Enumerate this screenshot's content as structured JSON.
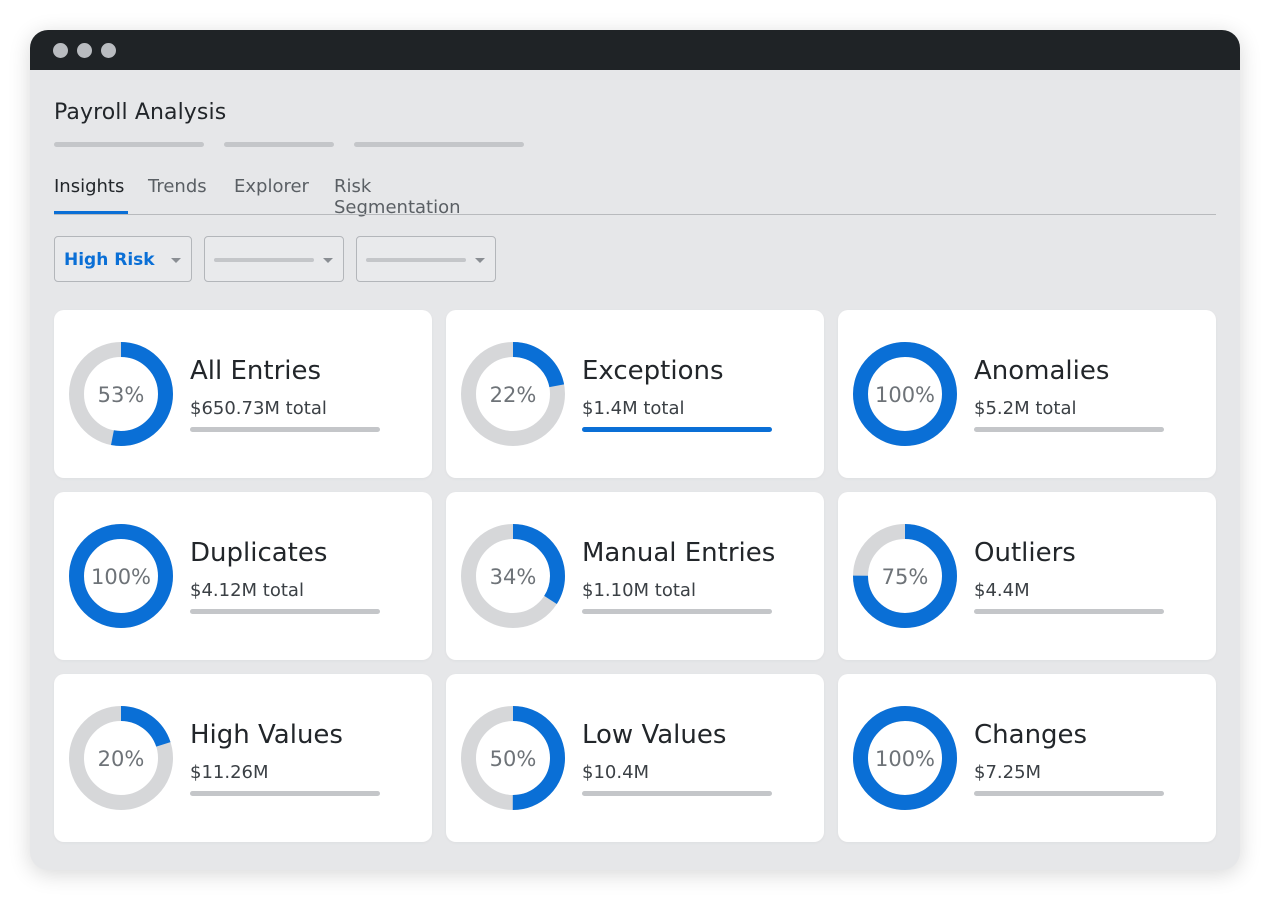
{
  "app": {
    "title": "Payroll Analysis"
  },
  "tabs": [
    {
      "label": "Insights",
      "active": true
    },
    {
      "label": "Trends",
      "active": false
    },
    {
      "label": "Explorer",
      "active": false
    },
    {
      "label": "Risk Segmentation",
      "active": false
    }
  ],
  "filters": [
    {
      "value": "High Risk"
    },
    {
      "value": ""
    },
    {
      "value": ""
    }
  ],
  "colors": {
    "accent": "#0a6fd6",
    "track": "#d6d7d9",
    "card_bg": "#ffffff",
    "window_bg": "#e6e7e9",
    "titlebar": "#1f2326"
  },
  "cards": [
    {
      "title": "All Entries",
      "percent": 53,
      "percent_label": "53%",
      "amount": "$650.73M total",
      "bar_active": false
    },
    {
      "title": "Exceptions",
      "percent": 22,
      "percent_label": "22%",
      "amount": "$1.4M total",
      "bar_active": true
    },
    {
      "title": "Anomalies",
      "percent": 100,
      "percent_label": "100%",
      "amount": "$5.2M total",
      "bar_active": false
    },
    {
      "title": "Duplicates",
      "percent": 100,
      "percent_label": "100%",
      "amount": "$4.12M total",
      "bar_active": false
    },
    {
      "title": "Manual Entries",
      "percent": 34,
      "percent_label": "34%",
      "amount": "$1.10M total",
      "bar_active": false
    },
    {
      "title": "Outliers",
      "percent": 75,
      "percent_label": "75%",
      "amount": "$4.4M",
      "bar_active": false
    },
    {
      "title": "High Values",
      "percent": 20,
      "percent_label": "20%",
      "amount": "$11.26M",
      "bar_active": false
    },
    {
      "title": "Low Values",
      "percent": 50,
      "percent_label": "50%",
      "amount": "$10.4M",
      "bar_active": false
    },
    {
      "title": "Changes",
      "percent": 100,
      "percent_label": "100%",
      "amount": "$7.25M",
      "bar_active": false
    }
  ]
}
